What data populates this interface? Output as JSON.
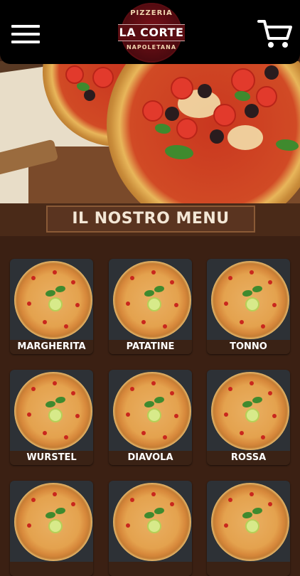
{
  "header": {
    "menu_icon": "hamburger-menu-icon",
    "cart_icon": "shopping-cart-icon",
    "logo": {
      "top_text": "PIZZERIA",
      "main_text": "LA CORTE",
      "bottom_text": "NAPOLETANA"
    }
  },
  "section": {
    "title": "IL NOSTRO MENU"
  },
  "menu_items": [
    {
      "label": "MARGHERITA"
    },
    {
      "label": "PATATINE"
    },
    {
      "label": "TONNO"
    },
    {
      "label": "WURSTEL"
    },
    {
      "label": "DIAVOLA"
    },
    {
      "label": "ROSSA"
    },
    {
      "label": ""
    },
    {
      "label": ""
    },
    {
      "label": ""
    }
  ],
  "colors": {
    "background": "#3b2013",
    "header": "#000000",
    "banner": "#5a3420",
    "label_bg": "#3a2215"
  }
}
